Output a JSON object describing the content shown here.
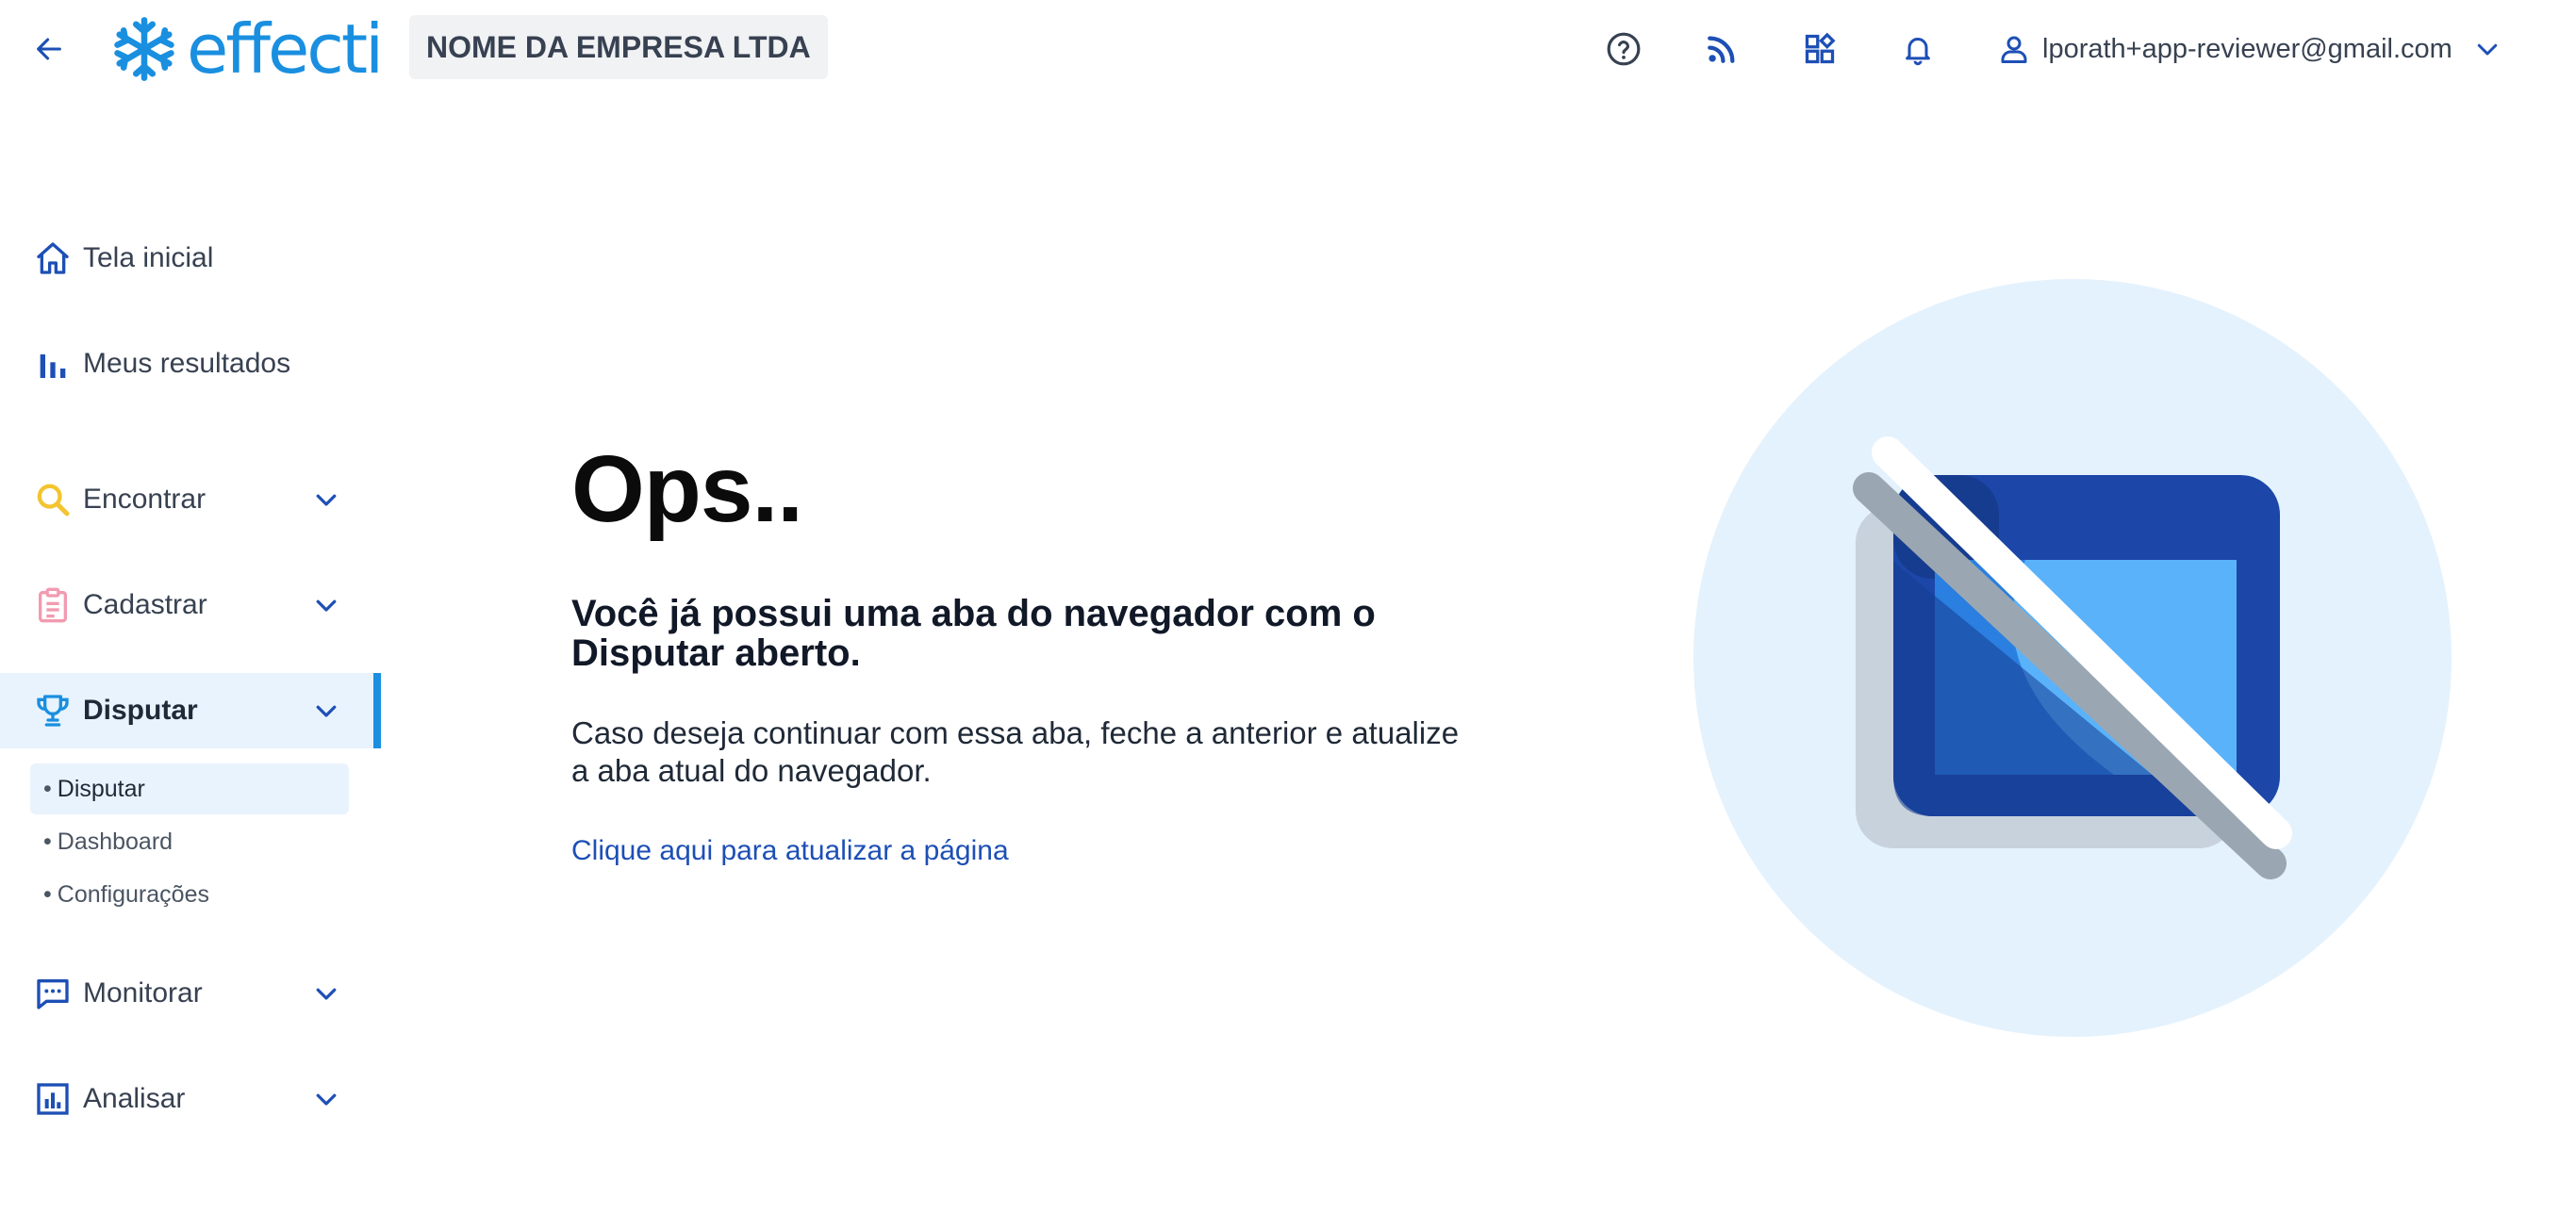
{
  "header": {
    "logo_text": "effecti",
    "company_name": "NOME DA EMPRESA LTDA",
    "user_email": "lporath+app-reviewer@gmail.com",
    "icons": [
      "help-icon",
      "rss-feed-icon",
      "apps-grid-icon",
      "bell-icon",
      "user-icon"
    ]
  },
  "sidebar": {
    "items": [
      {
        "label": "Tela inicial",
        "icon": "home-icon"
      },
      {
        "label": "Meus resultados",
        "icon": "bar-chart-icon"
      },
      {
        "label": "Encontrar",
        "icon": "search-icon"
      },
      {
        "label": "Cadastrar",
        "icon": "clipboard-icon"
      },
      {
        "label": "Disputar",
        "icon": "trophy-icon",
        "active": true
      },
      {
        "label": "Monitorar",
        "icon": "chat-icon"
      },
      {
        "label": "Analisar",
        "icon": "analytics-icon"
      }
    ],
    "disputar_sub": [
      {
        "label": "Disputar",
        "active": true
      },
      {
        "label": "Dashboard"
      },
      {
        "label": "Configurações"
      }
    ],
    "bullet": "•"
  },
  "main": {
    "title": "Ops..",
    "subtitle": "Você já possui uma aba do navegador com o Disputar aberto.",
    "description": "Caso deseja continuar com essa aba, feche a anterior e atualize a aba atual do navegador.",
    "refresh_link": "Clique aqui para atualizar a página"
  },
  "colors": {
    "brand": "#1a8fe0",
    "link": "#1d4fb5",
    "icon_blue": "#1d4fb5",
    "search_yellow": "#f4c430",
    "clipboard_pink": "#f29bb0",
    "active_bg": "#e8f3fd",
    "illustration_circle": "#e4f2fd"
  }
}
